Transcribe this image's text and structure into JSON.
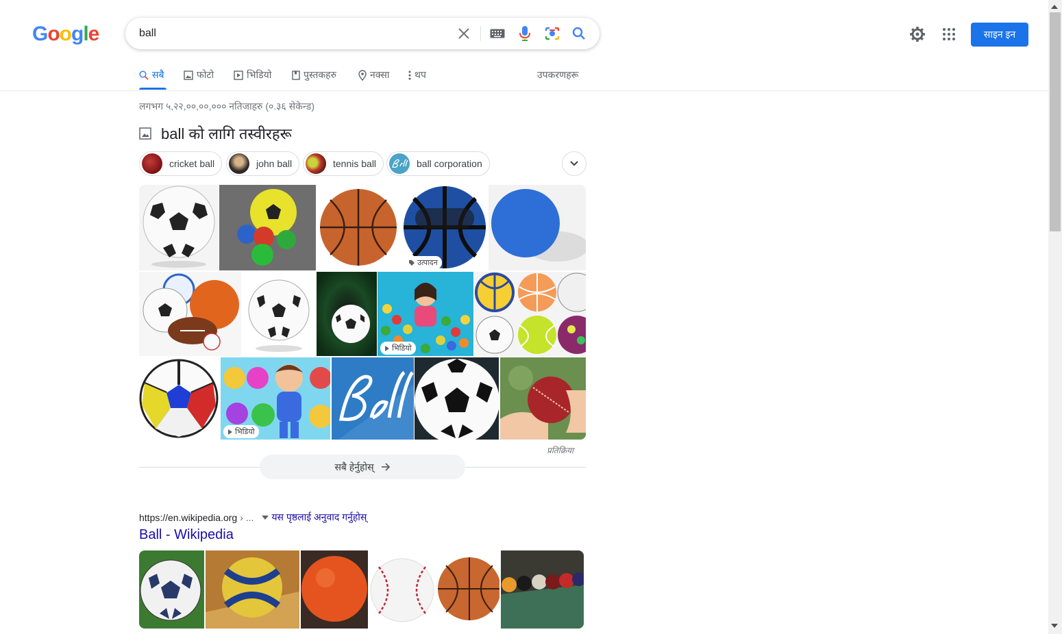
{
  "logo": {
    "letters": [
      "G",
      "o",
      "o",
      "g",
      "l",
      "e"
    ],
    "colors": [
      "#4285f4",
      "#ea4335",
      "#fbbc05",
      "#4285f4",
      "#34a853",
      "#ea4335"
    ]
  },
  "search": {
    "value": "ball"
  },
  "header": {
    "signin_label": "साइन इन",
    "icons": [
      "settings-gear-icon",
      "apps-grid-icon"
    ]
  },
  "tabs": [
    {
      "label": "सबै",
      "icon": "search-icon",
      "active": true
    },
    {
      "label": "फोटो",
      "icon": "image-icon",
      "active": false
    },
    {
      "label": "भिडियो",
      "icon": "video-icon",
      "active": false
    },
    {
      "label": "पुस्तकहरु",
      "icon": "book-icon",
      "active": false
    },
    {
      "label": "नक्सा",
      "icon": "map-pin-icon",
      "active": false
    },
    {
      "label": "थप",
      "icon": "more-vert-icon",
      "active": false
    }
  ],
  "tools_label": "उपकरणहरू",
  "result_stats": "लगभग ५,२२,००,००,००० नतिजाहरु (०.३६ सेकेन्ड)",
  "images_heading": "ball को लागि तस्वीरहरू",
  "chips": [
    {
      "label": "cricket ball"
    },
    {
      "label": "john ball"
    },
    {
      "label": "tennis ball"
    },
    {
      "label": "ball corporation"
    }
  ],
  "badges": {
    "product": "उत्पादन",
    "video": "भिडियो"
  },
  "feedback_label": "प्रतिक्रिया",
  "see_all_label": "सबै हेर्नुहोस्",
  "wiki_result": {
    "cite": "https://en.wikipedia.org",
    "cite_sep": "› ...",
    "translate": "यस पृष्ठलाई अनुवाद गर्नुहोस्",
    "title": "Ball - Wikipedia"
  },
  "colors": {
    "accent": "#1a73e8",
    "link": "#1a0dab"
  }
}
